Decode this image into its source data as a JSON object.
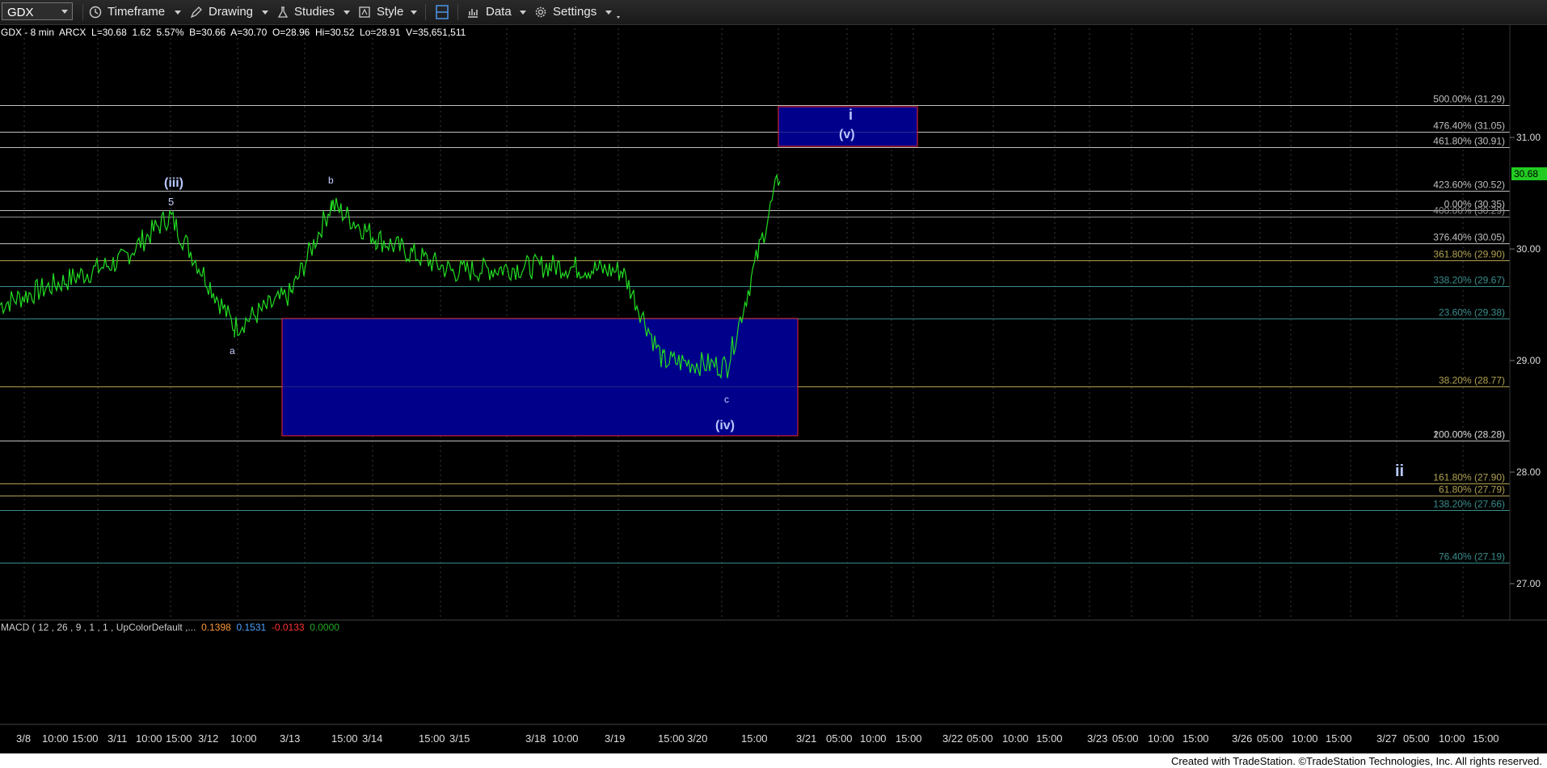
{
  "toolbar": {
    "symbol": "GDX",
    "timeframe": "Timeframe",
    "drawing": "Drawing",
    "studies": "Studies",
    "style": "Style",
    "data": "Data",
    "settings": "Settings"
  },
  "info": {
    "title": "GDX - 8 min",
    "exchange": "ARCX",
    "last": "L=30.68",
    "change": "1.62",
    "pct": "5.57%",
    "bid": "B=30.66",
    "ask": "A=30.70",
    "open": "O=28.96",
    "high": "Hi=30.52",
    "low": "Lo=28.91",
    "volume": "V=35,651,511"
  },
  "macd": {
    "label": "MACD ( 12 , 26 , 9 , 1 , 1 , UpColorDefault ,...",
    "v1": "0.1398",
    "v2": "0.1531",
    "v3": "-0.0133",
    "v4": "0.0000",
    "v1_color": "#ff9a3c",
    "v2_color": "#4aa3ff",
    "v3_color": "#ff3030",
    "v4_color": "#22aa22"
  },
  "price_axis": [
    "31.00",
    "30.00",
    "29.00",
    "28.00",
    "27.00"
  ],
  "last_price_tag": "30.68",
  "date_axis": [
    "3/8",
    "10:00",
    "15:00",
    "3/11",
    "10:00",
    "15:00",
    "3/12",
    "10:00",
    "3/13",
    "15:00",
    "3/14",
    "15:00",
    "3/15",
    "3/18",
    "10:00",
    "3/19",
    "15:00",
    "3/20",
    "15:00",
    "3/21",
    "05:00",
    "10:00",
    "15:00",
    "3/22",
    "05:00",
    "10:00",
    "15:00",
    "3/23",
    "05:00",
    "10:00",
    "15:00",
    "3/26",
    "05:00",
    "10:00",
    "15:00",
    "3/27",
    "05:00",
    "10:00",
    "15:00"
  ],
  "fib_levels": [
    {
      "label": "500.00% (31.29)",
      "color": "#c0c0c0"
    },
    {
      "label": "476.40% (31.05)",
      "color": "#c0c0c0"
    },
    {
      "label": "461.80% (30.91)",
      "color": "#c0c0c0"
    },
    {
      "label": "423.60% (30.52)",
      "color": "#c0c0c0"
    },
    {
      "label": "0.00% (30.35)",
      "color": "#c0c0c0"
    },
    {
      "label": "400.00% (30.29)",
      "color": "#909090"
    },
    {
      "label": "376.40% (30.05)",
      "color": "#c0c0c0"
    },
    {
      "label": "361.80% (29.90)",
      "color": "#b0a050"
    },
    {
      "label": "338.20% (29.67)",
      "color": "#3a8c8c"
    },
    {
      "label": "23.60% (29.38)",
      "color": "#3a8c8c"
    },
    {
      "label": "38.20% (28.77)",
      "color": "#b0a050"
    },
    {
      "label": "200.00% (28.28)",
      "color": "#c0c0c0"
    },
    {
      "label": "100.00% (28.28)",
      "color": "#c0c0c0"
    },
    {
      "label": "161.80% (27.90)",
      "color": "#b0a050"
    },
    {
      "label": "61.80% (27.79)",
      "color": "#b0a050"
    },
    {
      "label": "138.20% (27.66)",
      "color": "#3a8c8c"
    },
    {
      "label": "76.40% (27.19)",
      "color": "#3a8c8c"
    }
  ],
  "wave_labels": {
    "iii": "(iii)",
    "five": "5",
    "a": "a",
    "b": "b",
    "c": "c",
    "iv": "(iv)",
    "i": "i",
    "v": "(v)",
    "ii": "ii"
  },
  "chart_data": {
    "type": "line",
    "symbol": "GDX",
    "interval": "8 min",
    "ylim": [
      26.6,
      31.6
    ],
    "x": [
      "3/8",
      "3/11",
      "3/11 15:00",
      "3/12 10:00",
      "3/13",
      "3/13 15:00",
      "3/14",
      "3/15",
      "3/18",
      "3/19",
      "3/19 15:00",
      "3/20",
      "3/20 15:00"
    ],
    "values": [
      29.5,
      29.9,
      30.3,
      29.3,
      29.6,
      30.4,
      30.1,
      29.8,
      29.85,
      29.8,
      29.0,
      28.95,
      30.68
    ]
  },
  "footer": "Created with TradeStation. ©TradeStation Technologies, Inc. All rights reserved."
}
